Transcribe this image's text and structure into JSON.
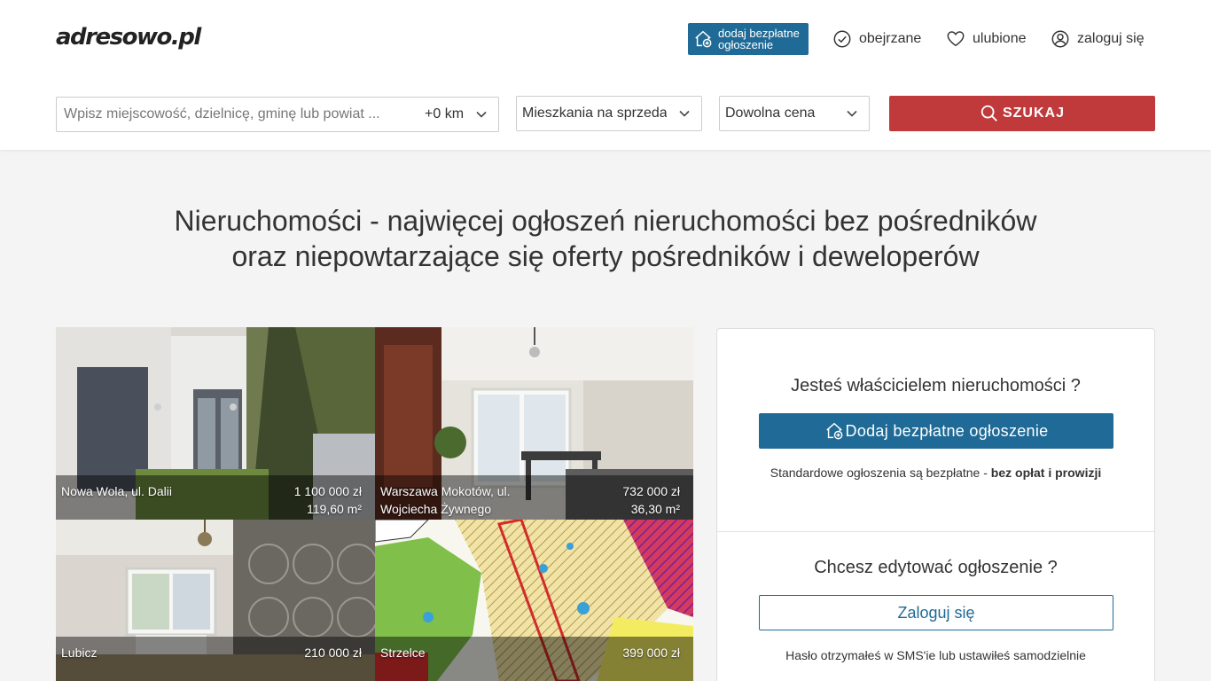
{
  "brand": {
    "logo_text": "adresowo.pl"
  },
  "header": {
    "add_listing_label": "dodaj bezpłatne\nogłoszenie",
    "nav": {
      "viewed": "obejrzane",
      "favorites": "ulubione",
      "login": "zaloguj się"
    }
  },
  "search": {
    "placeholder": "Wpisz miejscowość, dzielnicę, gminę lub powiat ...",
    "radius": "+0 km",
    "category": "Mieszkania na sprzedaż",
    "price": "Dowolna cena",
    "button_label": "SZUKAJ"
  },
  "headline": {
    "line1": "Nieruchomości - najwięcej ogłoszeń nieruchomości bez pośredników",
    "line2": "oraz niepowtarzające się oferty pośredników i deweloperów"
  },
  "listings": [
    {
      "location": "Nowa Wola, ul. Dalii",
      "price": "1 100 000 zł",
      "area": "119,60 m²"
    },
    {
      "location": "Warszawa Mokotów, ul. Wojciecha Żywnego",
      "price": "732 000 zł",
      "area": "36,30 m²"
    },
    {
      "location": "Lubicz",
      "price": "210 000 zł",
      "area": ""
    },
    {
      "location": "Strzelce",
      "price": "399 000 zł",
      "area": ""
    }
  ],
  "owner_panel": {
    "title": "Jesteś właścicielem nieruchomości ?",
    "button_label": "Dodaj bezpłatne ogłoszenie",
    "note_prefix": "Standardowe ogłoszenia są bezpłatne - ",
    "note_bold": "bez opłat i prowizji"
  },
  "edit_panel": {
    "title": "Chcesz edytować ogłoszenie ?",
    "button_label": "Zaloguj się",
    "note": "Hasło otrzymałeś w SMS'ie lub ustawiłeś samodzielnie"
  },
  "colors": {
    "primary": "#1f6a96",
    "search_button": "#c0393b",
    "background": "#f4f4f4"
  },
  "icons": {
    "add": "house-plus-icon",
    "viewed": "check-circle-icon",
    "favorites": "heart-icon",
    "login": "user-circle-icon",
    "search": "magnifier-icon",
    "dropdown": "chevron-down-icon"
  }
}
